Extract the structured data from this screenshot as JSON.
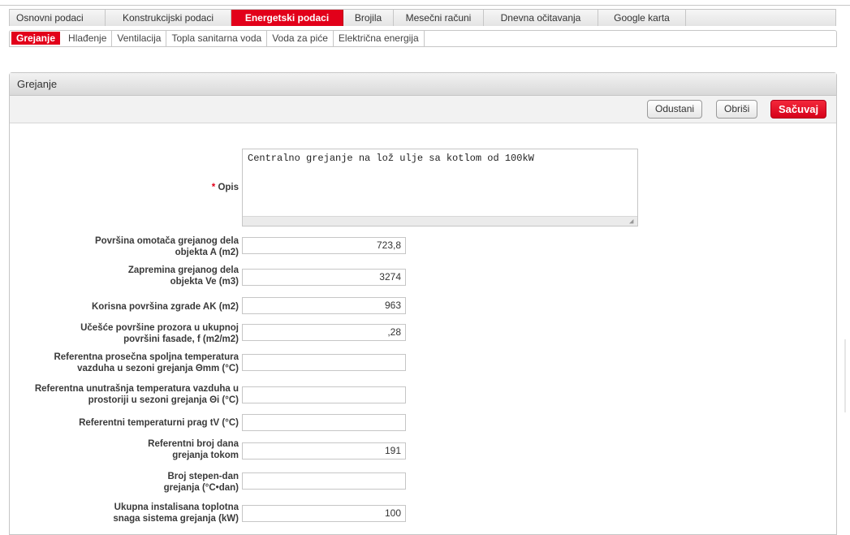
{
  "tabs_primary": [
    {
      "label": "Osnovni podaci",
      "width": 118
    },
    {
      "label": "Konstrukcijski podaci",
      "width": 155
    },
    {
      "label": "Energetski podaci",
      "width": 138,
      "active": true
    },
    {
      "label": "Brojila",
      "width": 62
    },
    {
      "label": "Mesečni računi",
      "width": 111
    },
    {
      "label": "Dnevna očitavanja",
      "width": 141
    },
    {
      "label": "Google karta",
      "width": 108
    }
  ],
  "tabs_secondary": [
    {
      "label": "Grejanje",
      "active": true
    },
    {
      "label": "Hlađenje"
    },
    {
      "label": "Ventilacija"
    },
    {
      "label": "Topla sanitarna voda"
    },
    {
      "label": "Voda za piće"
    },
    {
      "label": "Električna energija"
    }
  ],
  "panel": {
    "title": "Grejanje",
    "buttons": {
      "cancel": "Odustani",
      "delete": "Obriši",
      "save": "Sačuvaj"
    }
  },
  "form": {
    "description": {
      "required_mark": "*",
      "label": "Opis",
      "value": "Centralno grejanje na lož ulje sa kotlom od 100kW"
    },
    "fields": [
      {
        "label": "Površina omotača grejanog dela objekta A (m2)",
        "value": "723,8"
      },
      {
        "label": "Zapremina grejanog dela objekta Ve (m3)",
        "value": "3274"
      },
      {
        "label": "Korisna površina zgrade AK (m2)",
        "value": "963"
      },
      {
        "label": "Učešće površine prozora u ukupnoj površini fasade, f (m2/m2)",
        "value": ",28"
      },
      {
        "label": "Referentna prosečna spoljna temperatura vazduha u sezoni grejanja Θmm (°C)",
        "value": ""
      },
      {
        "label": "Referentna unutrašnja temperatura vazduha u prostoriji u sezoni grejanja Θi (°C)",
        "value": ""
      },
      {
        "label": "Referentni temperaturni prag tV (°C)",
        "value": ""
      },
      {
        "label": "Referentni broj dana grejanja tokom",
        "value": "191"
      },
      {
        "label": "Broj stepen-dan grejanja (°C•dan)",
        "value": ""
      },
      {
        "label": "Ukupna instalisana toplotna snaga sistema grejanja (kW)",
        "value": "100"
      }
    ]
  }
}
